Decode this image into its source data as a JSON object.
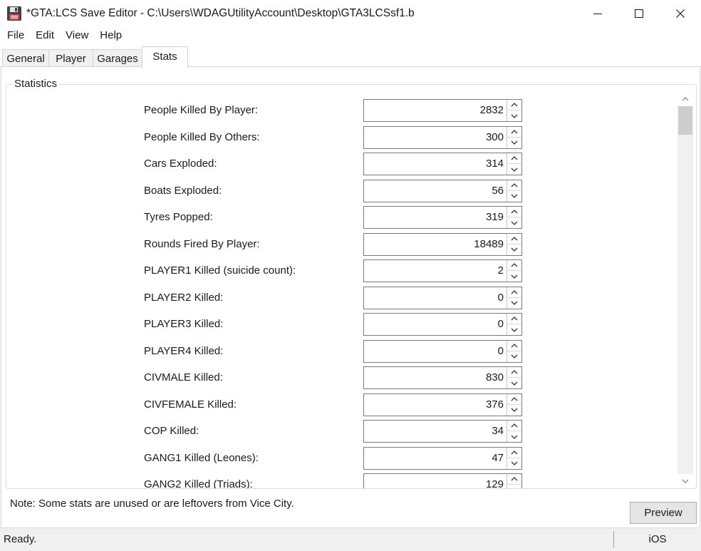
{
  "window": {
    "title": "*GTA:LCS Save Editor - C:\\Users\\WDAGUtilityAccount\\Desktop\\GTA3LCSsf1.b"
  },
  "menu": [
    "File",
    "Edit",
    "View",
    "Help"
  ],
  "tabs": [
    {
      "label": "General",
      "active": false
    },
    {
      "label": "Player",
      "active": false
    },
    {
      "label": "Garages",
      "active": false
    },
    {
      "label": "Stats",
      "active": true
    }
  ],
  "statistics": {
    "group_title": "Statistics",
    "rows": [
      {
        "label": "People Killed By Player:",
        "value": "2832"
      },
      {
        "label": "People Killed By Others:",
        "value": "300"
      },
      {
        "label": "Cars Exploded:",
        "value": "314"
      },
      {
        "label": "Boats Exploded:",
        "value": "56"
      },
      {
        "label": "Tyres Popped:",
        "value": "319"
      },
      {
        "label": "Rounds Fired By Player:",
        "value": "18489"
      },
      {
        "label": "PLAYER1 Killed (suicide count):",
        "value": "2"
      },
      {
        "label": "PLAYER2 Killed:",
        "value": "0"
      },
      {
        "label": "PLAYER3 Killed:",
        "value": "0"
      },
      {
        "label": "PLAYER4 Killed:",
        "value": "0"
      },
      {
        "label": "CIVMALE Killed:",
        "value": "830"
      },
      {
        "label": "CIVFEMALE Killed:",
        "value": "376"
      },
      {
        "label": "COP Killed:",
        "value": "34"
      },
      {
        "label": "GANG1 Killed (Leones):",
        "value": "47"
      },
      {
        "label": "GANG2 Killed (Triads):",
        "value": "129"
      }
    ]
  },
  "note": "Note: Some stats are unused or are leftovers from Vice City.",
  "preview_button": "Preview",
  "status": {
    "text": "Ready.",
    "platform": "iOS"
  },
  "colors": {
    "window_bg": "#f0f0f0",
    "panel_bg": "#ffffff",
    "border": "#7a7a7a"
  }
}
